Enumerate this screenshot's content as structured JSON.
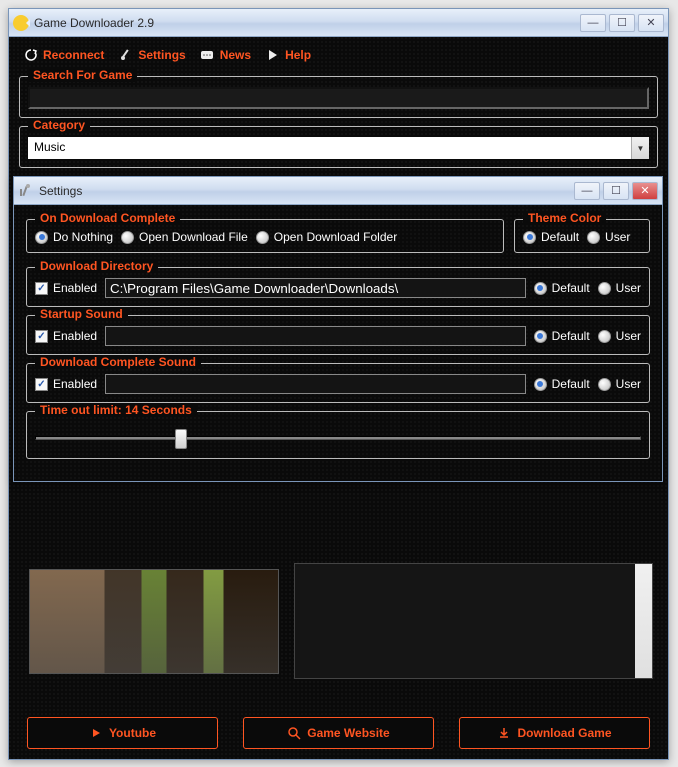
{
  "main": {
    "title": "Game Downloader 2.9",
    "toolbar": {
      "reconnect": "Reconnect",
      "settings": "Settings",
      "news": "News",
      "help": "Help"
    },
    "search": {
      "legend": "Search For Game",
      "value": ""
    },
    "category": {
      "legend": "Category",
      "value": "Music"
    },
    "buttons": {
      "youtube": "Youtube",
      "website": "Game Website",
      "download": "Download Game"
    }
  },
  "settings": {
    "title": "Settings",
    "onComplete": {
      "legend": "On Download Complete",
      "options": [
        "Do Nothing",
        "Open Download File",
        "Open Download Folder"
      ],
      "selected": 0
    },
    "theme": {
      "legend": "Theme Color",
      "options": [
        "Default",
        "User"
      ],
      "selected": 0
    },
    "downloadDir": {
      "legend": "Download Directory",
      "enabled_label": "Enabled",
      "enabled": true,
      "path": "C:\\Program Files\\Game Downloader\\Downloads\\",
      "options": [
        "Default",
        "User"
      ],
      "selected": 0
    },
    "startupSound": {
      "legend": "Startup Sound",
      "enabled_label": "Enabled",
      "enabled": true,
      "path": "",
      "options": [
        "Default",
        "User"
      ],
      "selected": 0
    },
    "completeSound": {
      "legend": "Download Complete Sound",
      "enabled_label": "Enabled",
      "enabled": true,
      "path": "",
      "options": [
        "Default",
        "User"
      ],
      "selected": 0
    },
    "timeout": {
      "legend": "Time out limit: 14 Seconds",
      "value": 14,
      "max": 60
    }
  }
}
